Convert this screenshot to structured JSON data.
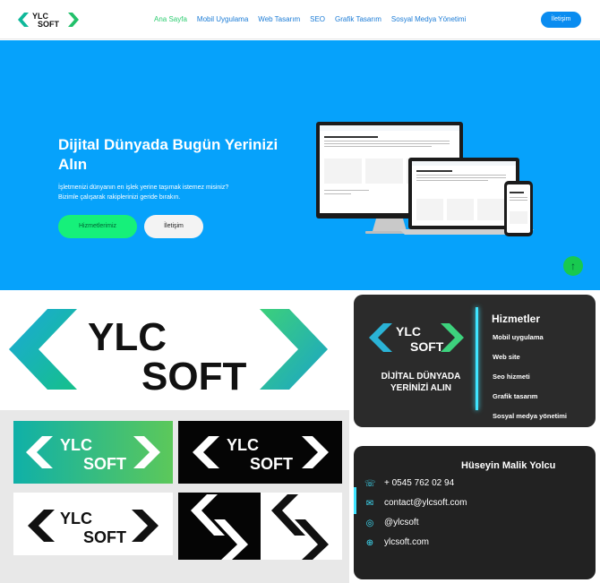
{
  "nav": {
    "logo_line1": "YLC",
    "logo_line2": "SOFT",
    "items": [
      "Ana Sayfa",
      "Mobil Uygulama",
      "Web Tasarım",
      "SEO",
      "Grafik Tasarım",
      "Sosyal Medya Yönetimi"
    ],
    "active_index": 0,
    "contact_button": "İletişim"
  },
  "hero": {
    "headline": "Dijital Dünyada Bugün Yerinizi Alın",
    "text_line1": "İşletmenizi dünyanın en işlek yerine taşımak istemez misiniz?",
    "text_line2": "Bizimle çalışarak rakiplerinizi geride bırakın.",
    "primary_button": "Hizmetlerimiz",
    "secondary_button": "İletişim",
    "up_icon": "arrow-up-icon"
  },
  "brand": {
    "big_line1": "YLC",
    "big_line2": "SOFT"
  },
  "gallery": {
    "tile1_line1": "YLC",
    "tile1_line2": "SOFT",
    "tile2_line1": "YLC",
    "tile2_line2": "SOFT",
    "tile3_line1": "YLC",
    "tile3_line2": "SOFT"
  },
  "services_card": {
    "logo_line1": "YLC",
    "logo_line2": "SOFT",
    "tagline_line1": "DİJİTAL DÜNYADA",
    "tagline_line2": "YERİNİZİ ALIN",
    "title": "Hizmetler",
    "items": [
      "Mobil uygulama",
      "Web site",
      "Seo hizmeti",
      "Grafik tasarım",
      "Sosyal medya yönetimi"
    ]
  },
  "contact_card": {
    "name": "Hüseyin Malik Yolcu",
    "phone": "+ 0545 762 02 94",
    "email": "contact@ylcsoft.com",
    "instagram": "@ylcsoft",
    "website": "ylcsoft.com"
  },
  "colors": {
    "hero_bg": "#06a2fb",
    "accent_green": "#16f07a",
    "nav_link": "#1a7bd6",
    "active_link": "#2ecc71",
    "cyan": "#3fe4ff"
  }
}
